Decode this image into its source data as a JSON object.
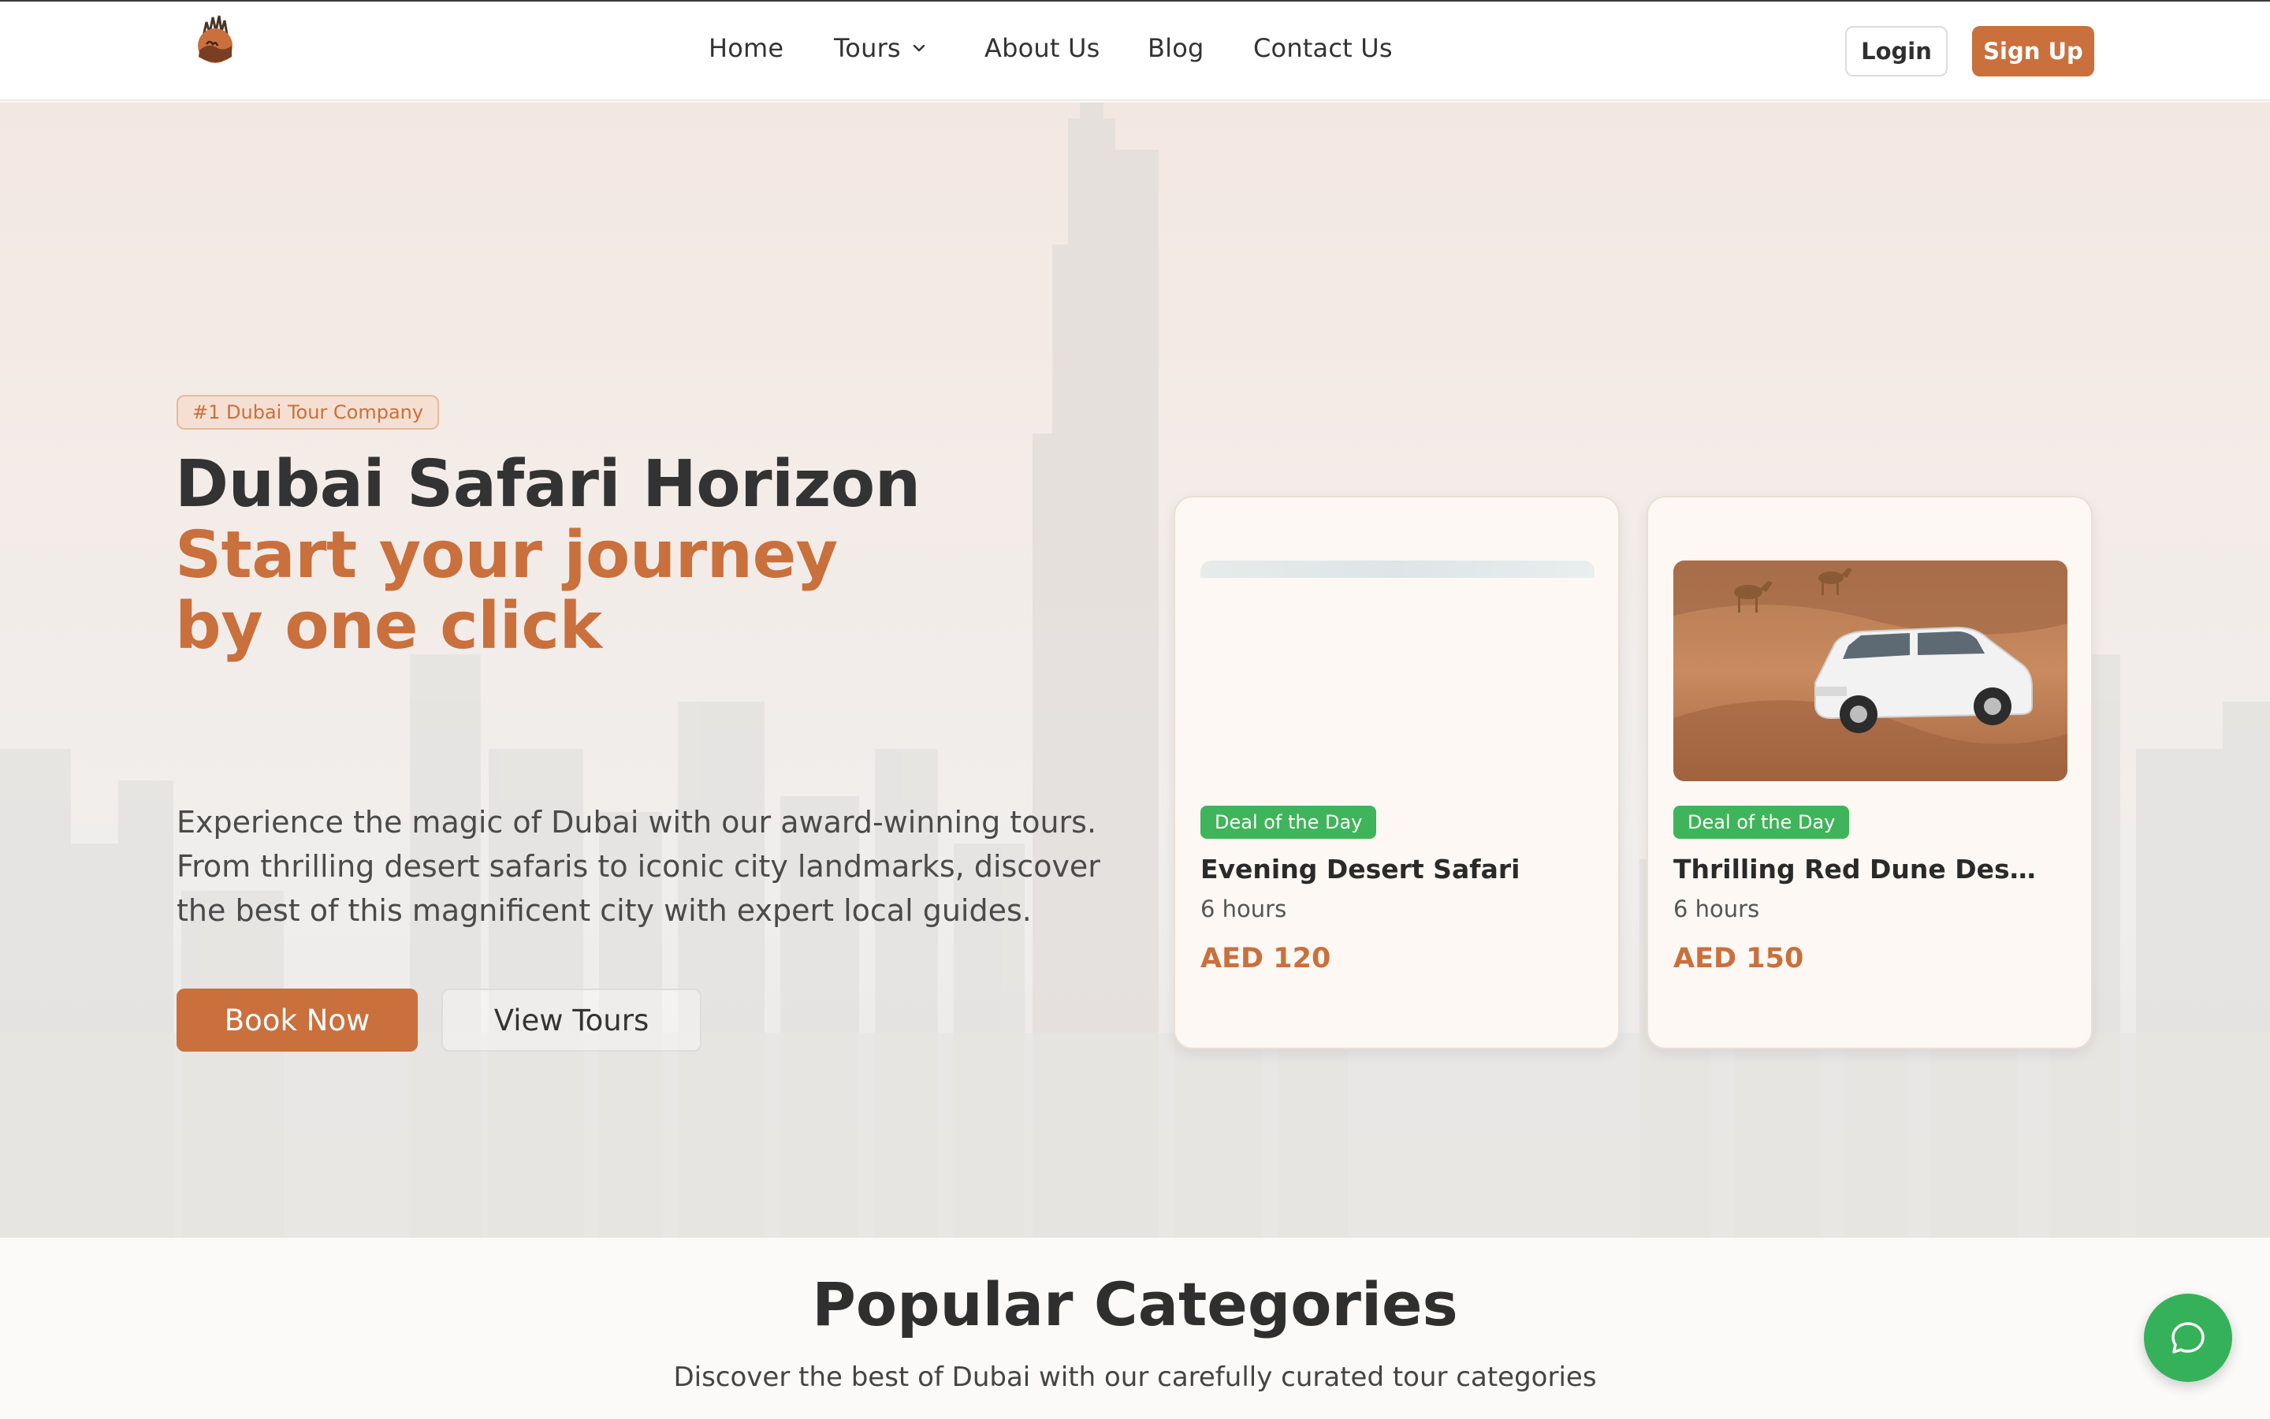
{
  "nav": {
    "items": [
      {
        "label": "Home"
      },
      {
        "label": "Tours"
      },
      {
        "label": "About Us"
      },
      {
        "label": "Blog"
      },
      {
        "label": "Contact Us"
      }
    ],
    "login_label": "Login",
    "signup_label": "Sign Up"
  },
  "hero": {
    "badge": "#1 Dubai Tour Company",
    "title": "Dubai Safari Horizon",
    "accent_line_1": "Start your journey",
    "accent_line_2": "by one click",
    "description": "Experience the magic of Dubai with our award-winning tours. From thrilling desert safaris to iconic city landmarks, discover the best of this magnificent city with expert local guides.",
    "book_label": "Book Now",
    "view_label": "View Tours"
  },
  "cards": [
    {
      "tag": "Deal of the Day",
      "title": "Evening Desert Safari",
      "duration": "6 hours",
      "price": "AED 120"
    },
    {
      "tag": "Deal of the Day",
      "title": "Thrilling Red Dune Desert…",
      "duration": "6 hours",
      "price": "AED 150"
    }
  ],
  "categories": {
    "title": "Popular Categories",
    "subtitle": "Discover the best of Dubai with our carefully curated tour categories"
  },
  "colors": {
    "accent": "#c9703d",
    "deal_green": "#3fb45a",
    "chat_green": "#35b15a"
  },
  "icons": {
    "logo": "camel-sunset-logo",
    "tours_dropdown": "chevron-down-icon",
    "chat": "chat-bubble-icon"
  }
}
